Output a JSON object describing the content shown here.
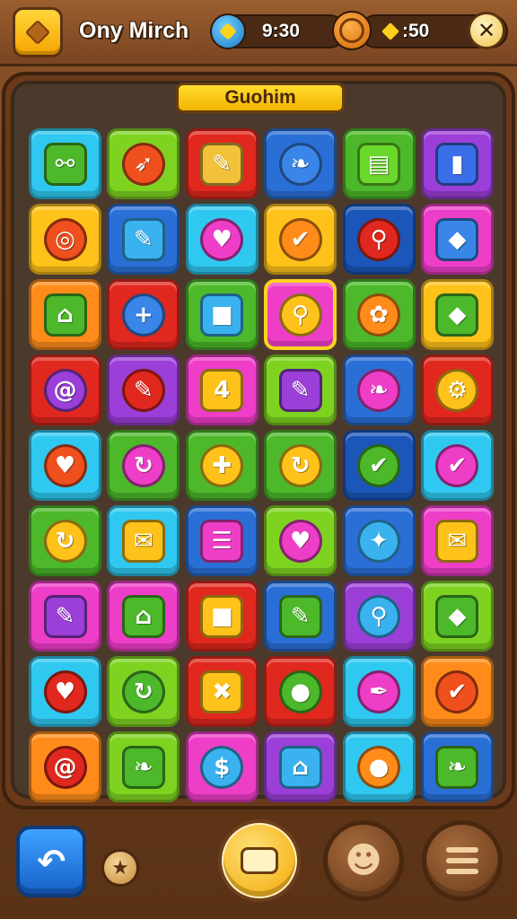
{
  "header": {
    "title": "Ony Mirch",
    "timer": "9:30",
    "coins": ":50"
  },
  "banner": {
    "label": "Guohim"
  },
  "colors": {
    "cyan": "#2fc8f0",
    "lime": "#7ed321",
    "red": "#e0281e",
    "blue": "#2a6fd6",
    "green": "#4cb82a",
    "purple": "#9b3fd8",
    "yellow": "#ffc21a",
    "orange": "#ff8c1a",
    "magenta": "#ee3ec8",
    "darkblue": "#1b56b8"
  },
  "grid": {
    "rows": [
      [
        {
          "color": "cyan",
          "icon": "link-icon",
          "glyph": "⚯",
          "gcolor": "#4cb82a",
          "shape": "sq"
        },
        {
          "color": "lime",
          "icon": "arrow-icon",
          "glyph": "➶",
          "gcolor": "#f0501e"
        },
        {
          "color": "red",
          "icon": "bone-icon",
          "glyph": "✎",
          "gcolor": "#f2c23a",
          "shape": "sq"
        },
        {
          "color": "blue",
          "icon": "leaf-icon",
          "glyph": "❧",
          "gcolor": "#3a86e8"
        },
        {
          "color": "green",
          "icon": "scroll-icon",
          "glyph": "▤",
          "gcolor": "#6ad82a",
          "shape": "sq"
        },
        {
          "color": "purple",
          "icon": "capsule-icon",
          "glyph": "▮",
          "gcolor": "#3a6ee8",
          "shape": "sq"
        }
      ],
      [
        {
          "color": "yellow",
          "icon": "ring-icon",
          "glyph": "◎",
          "gcolor": "#f0501e"
        },
        {
          "color": "blue",
          "icon": "pencil-icon",
          "glyph": "✎",
          "gcolor": "#3ab2f0",
          "shape": "sq"
        },
        {
          "color": "cyan",
          "icon": "heart-icon",
          "glyph": "♥",
          "gcolor": "#ee3ec8"
        },
        {
          "color": "yellow",
          "icon": "chat-bubble-icon",
          "glyph": "✔",
          "gcolor": "#ff8c1a"
        },
        {
          "color": "darkblue",
          "icon": "lollipop-icon",
          "glyph": "⚲",
          "gcolor": "#e0281e"
        },
        {
          "color": "magenta",
          "icon": "cube-icon",
          "glyph": "◆",
          "gcolor": "#3a86e8",
          "shape": "sq"
        }
      ],
      [
        {
          "color": "orange",
          "icon": "gift-icon",
          "glyph": "⌂",
          "gcolor": "#4cb82a",
          "shape": "sq"
        },
        {
          "color": "red",
          "icon": "plus-coin-icon",
          "glyph": "+",
          "gcolor": "#3a86e8"
        },
        {
          "color": "green",
          "icon": "square-icon",
          "glyph": "■",
          "gcolor": "#3ab2f0",
          "shape": "sq"
        },
        {
          "color": "magenta",
          "icon": "magnifier-icon",
          "glyph": "⚲",
          "gcolor": "#ffc21a",
          "selected": true
        },
        {
          "color": "green",
          "icon": "ribbon-icon",
          "glyph": "✿",
          "gcolor": "#ff8c1a"
        },
        {
          "color": "yellow",
          "icon": "box-icon",
          "glyph": "◆",
          "gcolor": "#4cb82a",
          "shape": "sq"
        }
      ],
      [
        {
          "color": "red",
          "icon": "swirl-icon",
          "glyph": "@",
          "gcolor": "#9b3fd8"
        },
        {
          "color": "purple",
          "icon": "pencil-icon",
          "glyph": "✎",
          "gcolor": "#e0281e"
        },
        {
          "color": "magenta",
          "icon": "number-four-icon",
          "glyph": "4",
          "gcolor": "#ffc21a",
          "shape": "sq"
        },
        {
          "color": "lime",
          "icon": "pen-icon",
          "glyph": "✎",
          "gcolor": "#9b3fd8",
          "shape": "sq"
        },
        {
          "color": "blue",
          "icon": "feather-icon",
          "glyph": "❧",
          "gcolor": "#ee3ec8"
        },
        {
          "color": "red",
          "icon": "gear-icon",
          "glyph": "⚙",
          "gcolor": "#ffc21a"
        }
      ],
      [
        {
          "color": "cyan",
          "icon": "heart-icon",
          "glyph": "♥",
          "gcolor": "#f0501e"
        },
        {
          "color": "green",
          "icon": "refresh-icon",
          "glyph": "↻",
          "gcolor": "#ee3ec8"
        },
        {
          "color": "green",
          "icon": "cross-icon",
          "glyph": "✚",
          "gcolor": "#ffc21a"
        },
        {
          "color": "green",
          "icon": "refresh-icon",
          "glyph": "↻",
          "gcolor": "#ffc21a"
        },
        {
          "color": "darkblue",
          "icon": "chat-bubble-icon",
          "glyph": "✔",
          "gcolor": "#4cb82a"
        },
        {
          "color": "cyan",
          "icon": "check-icon",
          "glyph": "✔",
          "gcolor": "#ee3ec8"
        }
      ],
      [
        {
          "color": "green",
          "icon": "ring-icon",
          "glyph": "↻",
          "gcolor": "#ffc21a"
        },
        {
          "color": "cyan",
          "icon": "envelope-icon",
          "glyph": "✉",
          "gcolor": "#ffc21a",
          "shape": "sq"
        },
        {
          "color": "blue",
          "icon": "stripes-icon",
          "glyph": "☰",
          "gcolor": "#ee3ec8",
          "shape": "sq"
        },
        {
          "color": "lime",
          "icon": "heart-icon",
          "glyph": "♥",
          "gcolor": "#ee3ec8"
        },
        {
          "color": "blue",
          "icon": "star-icon",
          "glyph": "✦",
          "gcolor": "#3ab2f0"
        },
        {
          "color": "magenta",
          "icon": "envelope-icon",
          "glyph": "✉",
          "gcolor": "#ffc21a",
          "shape": "sq"
        }
      ],
      [
        {
          "color": "magenta",
          "icon": "pencil-icon",
          "glyph": "✎",
          "gcolor": "#9b3fd8",
          "shape": "sq"
        },
        {
          "color": "magenta",
          "icon": "bank-icon",
          "glyph": "⌂",
          "gcolor": "#4cb82a",
          "shape": "sq"
        },
        {
          "color": "red",
          "icon": "square-icon",
          "glyph": "■",
          "gcolor": "#ffc21a",
          "shape": "sq"
        },
        {
          "color": "blue",
          "icon": "pen-icon",
          "glyph": "✎",
          "gcolor": "#4cb82a",
          "shape": "sq"
        },
        {
          "color": "purple",
          "icon": "magnifier-icon",
          "glyph": "⚲",
          "gcolor": "#3ab2f0"
        },
        {
          "color": "lime",
          "icon": "cube-icon",
          "glyph": "◆",
          "gcolor": "#4cb82a",
          "shape": "sq"
        }
      ],
      [
        {
          "color": "cyan",
          "icon": "heart-icon",
          "glyph": "♥",
          "gcolor": "#e0281e"
        },
        {
          "color": "lime",
          "icon": "refresh-icon",
          "glyph": "↻",
          "gcolor": "#4cb82a"
        },
        {
          "color": "red",
          "icon": "crossed-tools-icon",
          "glyph": "✖",
          "gcolor": "#ffc21a",
          "shape": "sq"
        },
        {
          "color": "red",
          "icon": "chat-bubble-icon",
          "glyph": "●",
          "gcolor": "#4cb82a"
        },
        {
          "color": "cyan",
          "icon": "pen-nib-icon",
          "glyph": "✒",
          "gcolor": "#ee3ec8"
        },
        {
          "color": "orange",
          "icon": "check-coin-icon",
          "glyph": "✔",
          "gcolor": "#f0501e"
        }
      ],
      [
        {
          "color": "orange",
          "icon": "swirl-icon",
          "glyph": "@",
          "gcolor": "#e0281e"
        },
        {
          "color": "lime",
          "icon": "leaf-icon",
          "glyph": "❧",
          "gcolor": "#4cb82a",
          "shape": "sq"
        },
        {
          "color": "magenta",
          "icon": "coin-icon",
          "glyph": "$",
          "gcolor": "#3ab2f0"
        },
        {
          "color": "purple",
          "icon": "house-icon",
          "glyph": "⌂",
          "gcolor": "#3ab2f0",
          "shape": "sq"
        },
        {
          "color": "cyan",
          "icon": "chat-bubble-icon",
          "glyph": "●",
          "gcolor": "#ff8c1a"
        },
        {
          "color": "blue",
          "icon": "leaf-icon",
          "glyph": "❧",
          "gcolor": "#4cb82a",
          "shape": "sq"
        }
      ]
    ]
  },
  "controls": {
    "undo_icon": "undo-icon",
    "star_icon": "star-icon",
    "hint_icon": "hint-icon",
    "character_icon": "character-icon",
    "menu_icon": "menu-list-icon"
  }
}
